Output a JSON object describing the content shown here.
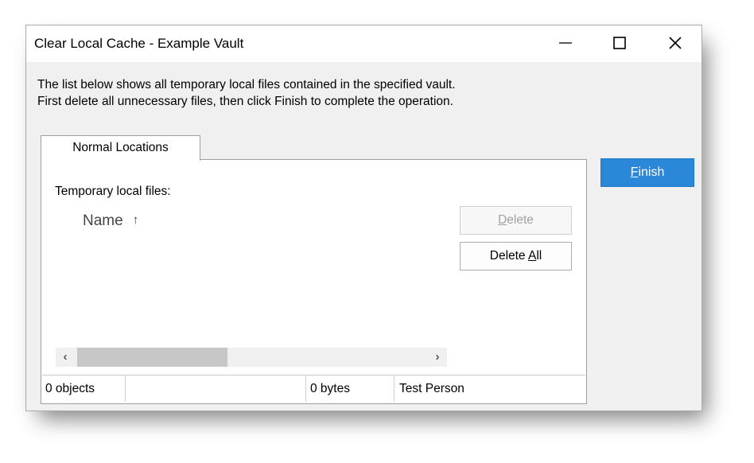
{
  "window": {
    "title": "Clear Local Cache - Example Vault",
    "controls": [
      "minimize-icon",
      "maximize-icon",
      "close-icon"
    ]
  },
  "description": {
    "line1": "The list below shows all temporary local files contained in the specified vault.",
    "line2": "First delete all unnecessary files, then click Finish to complete the operation."
  },
  "tabs": [
    {
      "label": "Normal Locations",
      "selected": true
    }
  ],
  "panel": {
    "label": "Temporary local files:",
    "list": {
      "columns": [
        {
          "label": "Name",
          "sort": "ascending",
          "sort_icon": "arrow-up-icon"
        }
      ],
      "rows": []
    },
    "buttons": {
      "delete": {
        "label_underlined": "D",
        "label_rest": "elete",
        "enabled": false
      },
      "delete_all": {
        "label_prefix": "Delete ",
        "label_underlined": "A",
        "label_rest": "ll",
        "enabled": true
      }
    }
  },
  "statusbar": {
    "count": "0 objects",
    "empty": "",
    "size": "0 bytes",
    "user": "Test Person"
  },
  "finish": {
    "label_underlined": "F",
    "label_rest": "inish"
  },
  "colors": {
    "accent": "#2b88d8",
    "disabled_text": "#a0a0a0",
    "dialog_bg": "#f0f0f0"
  }
}
